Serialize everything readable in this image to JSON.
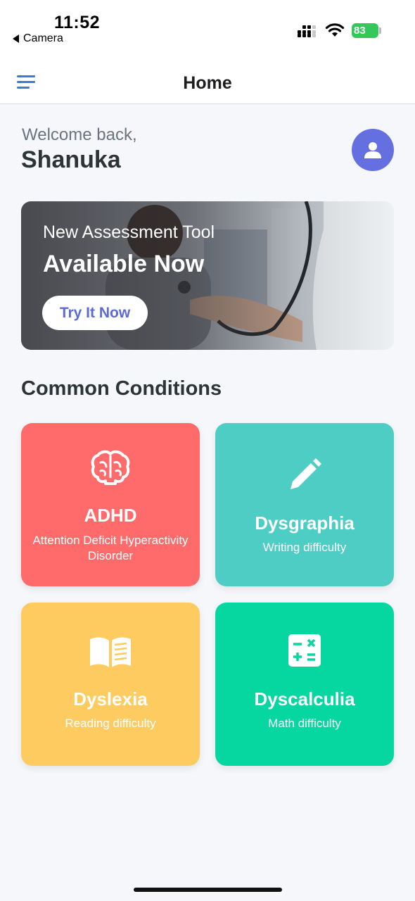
{
  "status_bar": {
    "time": "11:52",
    "back_app": "Camera",
    "battery": "83"
  },
  "header": {
    "title": "Home",
    "menu_icon": "hamburger-menu-icon"
  },
  "welcome": {
    "greeting": "Welcome back,",
    "name": "Shanuka",
    "avatar_icon": "user-icon"
  },
  "banner": {
    "subtitle": "New Assessment Tool",
    "title": "Available Now",
    "button_label": "Try It Now"
  },
  "section": {
    "title": "Common Conditions"
  },
  "conditions": [
    {
      "title": "ADHD",
      "description": "Attention Deficit Hyperactivity Disorder",
      "icon": "brain-icon",
      "color": "#ff6b6b"
    },
    {
      "title": "Dysgraphia",
      "description": "Writing difficulty",
      "icon": "pencil-icon",
      "color": "#4ecdc4"
    },
    {
      "title": "Dyslexia",
      "description": "Reading difficulty",
      "icon": "book-open-icon",
      "color": "#fdcb60"
    },
    {
      "title": "Dyscalculia",
      "description": "Math difficulty",
      "icon": "calculator-icon",
      "color": "#06d6a0"
    }
  ],
  "colors": {
    "accent": "#3a7bd5",
    "avatar": "#6470e0",
    "button_text": "#5b6ad6"
  }
}
